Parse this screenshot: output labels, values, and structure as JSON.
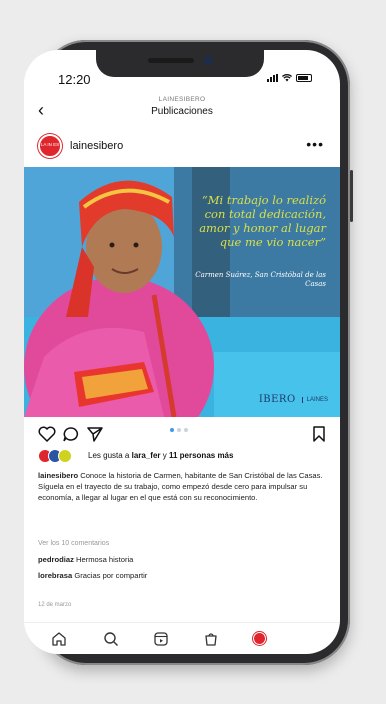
{
  "status": {
    "time": "12:20"
  },
  "nav": {
    "subtitle": "LAINESIBERO",
    "title": "Publicaciones"
  },
  "post": {
    "username": "lainesibero",
    "avatar_text": "LA IN ES",
    "quote": "“Mi trabajo lo realizó con total dedicación, amor y honor al lugar que me vio nacer”",
    "author": "Carmen Suárez, San Cristóbal de las Casas",
    "logo_primary": "IBERO",
    "logo_secondary": "LAINES",
    "carousel": {
      "count": 3,
      "active": 0
    }
  },
  "likes": {
    "prefix": "Les gusta a ",
    "first_user": "lara_fer",
    "connector": " y ",
    "others": "11 personas más"
  },
  "caption": {
    "user": "lainesibero",
    "text": " Conoce la historia de Carmen, habitante de San Cristóbal de las Casas. Síguela en el trayecto de su trabajo, como empezó desde cero para impulsar su economía, a llegar al lugar en el que está con su reconocimiento."
  },
  "view_comments": "Ver los 10 comentarios",
  "comments": [
    {
      "user": "pedrodiaz",
      "text": " Hermosa historia"
    },
    {
      "user": "lorebrasa",
      "text": " Gracias por compartir"
    }
  ],
  "date": "12 de marzo",
  "icons": [
    "back-icon",
    "more-icon",
    "heart-icon",
    "comment-icon",
    "share-icon",
    "bookmark-icon",
    "home-icon",
    "search-icon",
    "reels-icon",
    "shop-icon",
    "profile-icon"
  ],
  "colors": {
    "brand": "#e0262d",
    "quote": "#d8e04a",
    "link": "#3d9ae8"
  }
}
